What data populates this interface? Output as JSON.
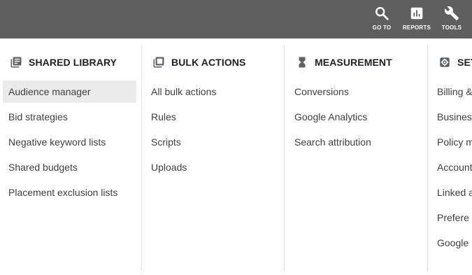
{
  "topbar": {
    "goto": {
      "label": "GO TO",
      "icon": "search-icon"
    },
    "reports": {
      "label": "REPORTS",
      "icon": "bar-chart-icon"
    },
    "tools": {
      "label": "TOOLS",
      "icon": "wrench-icon"
    }
  },
  "menu": {
    "columns": [
      {
        "title": "SHARED LIBRARY",
        "icon": "library-icon",
        "items": [
          "Audience manager",
          "Bid strategies",
          "Negative keyword lists",
          "Shared budgets",
          "Placement exclusion lists"
        ],
        "active_item": "Audience manager"
      },
      {
        "title": "BULK ACTIONS",
        "icon": "copy-stack-icon",
        "items": [
          "All bulk actions",
          "Rules",
          "Scripts",
          "Uploads"
        ]
      },
      {
        "title": "MEASUREMENT",
        "icon": "hourglass-icon",
        "items": [
          "Conversions",
          "Google Analytics",
          "Search attribution"
        ]
      },
      {
        "title": "SET",
        "icon": "settings-icon",
        "items": [
          "Billing &",
          "Busines",
          "Policy m",
          "Account",
          "Linked a",
          "Prefere",
          "Google I"
        ]
      }
    ]
  },
  "colors": {
    "topbar_bg": "#5f5f5f",
    "active_item_bg": "#ebebeb",
    "divider": "#e0e0e0",
    "text": "#3c4043"
  }
}
